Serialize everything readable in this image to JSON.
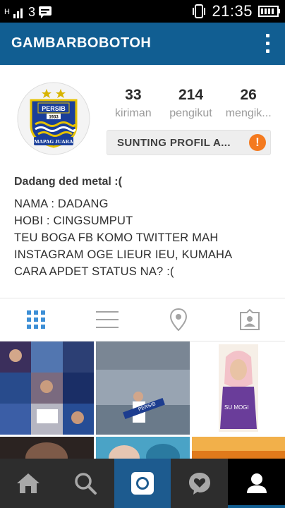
{
  "status_bar": {
    "network": "H",
    "notif_count": "3",
    "time": "21:35"
  },
  "app_bar": {
    "title": "GAMBARBOBOTOH"
  },
  "profile": {
    "avatar_text_top": "PERSIB",
    "avatar_year": "1933",
    "avatar_text_bottom": "MAPAG JUARA",
    "stats": [
      {
        "value": "33",
        "label": "kiriman"
      },
      {
        "value": "214",
        "label": "pengikut"
      },
      {
        "value": "26",
        "label": "mengik..."
      }
    ],
    "edit_button_label": "SUNTING PROFIL A...",
    "warning_symbol": "!"
  },
  "bio": {
    "name": "Dadang ded metal :(",
    "lines": [
      "NAMA : DADANG",
      "HOBI : CINGSUMPUT",
      "TEU BOGA FB KOMO TWITTER MAH",
      "INSTAGRAM OGE LIEUR IEU, KUMAHA",
      "CARA APDET STATUS NA? :("
    ]
  },
  "tabs": [
    {
      "icon": "grid-icon",
      "active": true
    },
    {
      "icon": "list-icon",
      "active": false
    },
    {
      "icon": "location-icon",
      "active": false
    },
    {
      "icon": "tagged-photos-icon",
      "active": false
    }
  ],
  "grid_tiles": [
    {
      "name": "photo-collage",
      "caption": ""
    },
    {
      "name": "photo-stadium",
      "caption": "PERSIB"
    },
    {
      "name": "photo-hijab",
      "caption": ""
    },
    {
      "name": "photo-dark-girl",
      "caption": ""
    },
    {
      "name": "photo-blue",
      "caption": ""
    },
    {
      "name": "photo-orange",
      "caption": ""
    }
  ],
  "bottom_nav": [
    {
      "icon": "home-icon"
    },
    {
      "icon": "search-icon"
    },
    {
      "icon": "camera-icon"
    },
    {
      "icon": "activity-icon"
    },
    {
      "icon": "profile-icon"
    }
  ],
  "colors": {
    "app_bar": "#115e92",
    "accent_orange": "#f47a1f",
    "nav_bg": "#2d2d2d"
  }
}
